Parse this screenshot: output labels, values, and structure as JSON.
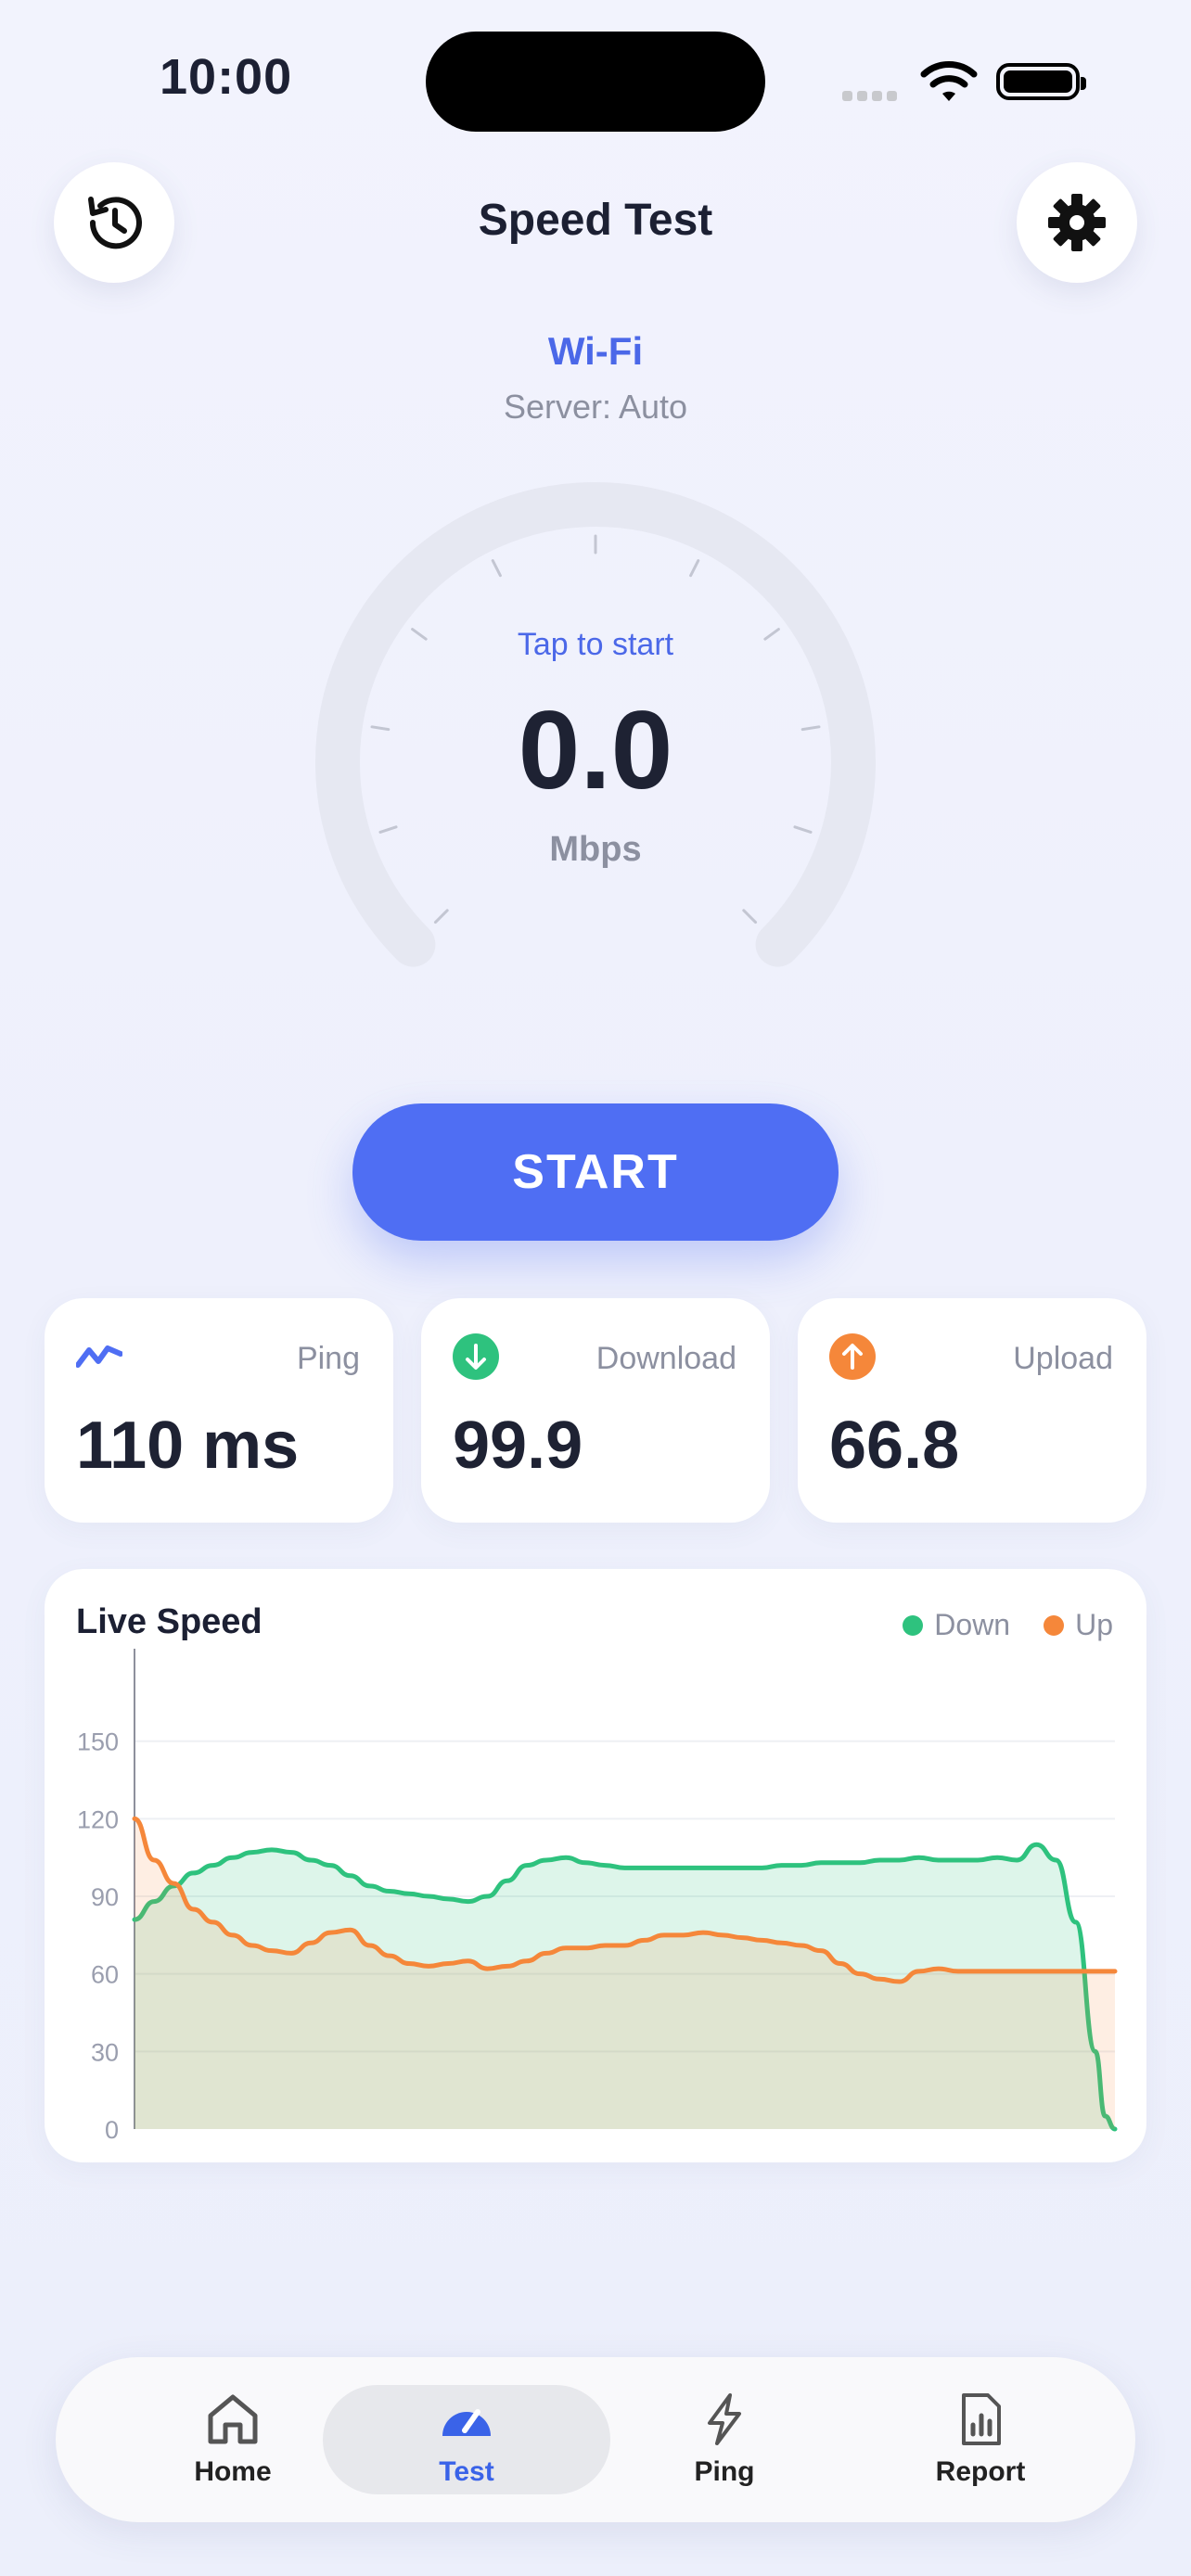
{
  "status_bar": {
    "time": "10:00"
  },
  "header": {
    "title": "Speed Test",
    "history_icon": "history-icon",
    "settings_icon": "gear-icon"
  },
  "network": {
    "name": "Wi-Fi",
    "server": "Server: Auto"
  },
  "gauge": {
    "prompt": "Tap to start",
    "value": "0.0",
    "unit": "Mbps"
  },
  "start_button": {
    "label": "START"
  },
  "stats": {
    "ping": {
      "label": "Ping",
      "value": "110 ms",
      "icon": "pulse-icon"
    },
    "download": {
      "label": "Download",
      "value": "99.9",
      "icon": "arrow-down-icon"
    },
    "upload": {
      "label": "Upload",
      "value": "66.8",
      "icon": "arrow-up-icon"
    }
  },
  "colors": {
    "accent": "#4f6ef3",
    "down": "#2ec27e",
    "up": "#f5873a"
  },
  "chart_data": {
    "type": "area",
    "title": "Live Speed",
    "ylim": [
      0,
      175
    ],
    "yticks": [
      0,
      30,
      60,
      90,
      120,
      150
    ],
    "grid": true,
    "legend_position": "top-right",
    "x": [
      0,
      2,
      4,
      6,
      8,
      10,
      12,
      14,
      16,
      18,
      20,
      22,
      24,
      26,
      28,
      30,
      32,
      34,
      36,
      38,
      40,
      42,
      44,
      46,
      48,
      50,
      52,
      54,
      56,
      58,
      60,
      62,
      64,
      66,
      68,
      70,
      72,
      74,
      76,
      78,
      80,
      82,
      84,
      86,
      88,
      90,
      92,
      94,
      96,
      98,
      99,
      100
    ],
    "series": [
      {
        "name": "Down",
        "color": "#2ec27e",
        "values": [
          81,
          88,
          94,
          99,
          102,
          105,
          107,
          108,
          107,
          104,
          102,
          98,
          94,
          92,
          91,
          90,
          89,
          88,
          90,
          96,
          102,
          104,
          105,
          103,
          102,
          101,
          101,
          101,
          101,
          101,
          101,
          101,
          101,
          102,
          102,
          103,
          103,
          103,
          104,
          104,
          105,
          104,
          104,
          104,
          105,
          104,
          110,
          104,
          80,
          30,
          5,
          0
        ]
      },
      {
        "name": "Up",
        "color": "#f5873a",
        "values": [
          120,
          104,
          95,
          85,
          80,
          75,
          71,
          69,
          68,
          72,
          76,
          77,
          71,
          67,
          64,
          63,
          64,
          65,
          62,
          63,
          65,
          68,
          70,
          70,
          71,
          71,
          73,
          75,
          75,
          76,
          75,
          74,
          73,
          72,
          71,
          69,
          64,
          60,
          58,
          57,
          61,
          62,
          61,
          61,
          61,
          61,
          61,
          61,
          61,
          61,
          61,
          61
        ]
      }
    ]
  },
  "tabbar": {
    "items": [
      {
        "label": "Home",
        "icon": "home-icon"
      },
      {
        "label": "Test",
        "icon": "speedometer-icon",
        "active": true
      },
      {
        "label": "Ping",
        "icon": "bolt-icon"
      },
      {
        "label": "Report",
        "icon": "report-icon"
      }
    ]
  }
}
